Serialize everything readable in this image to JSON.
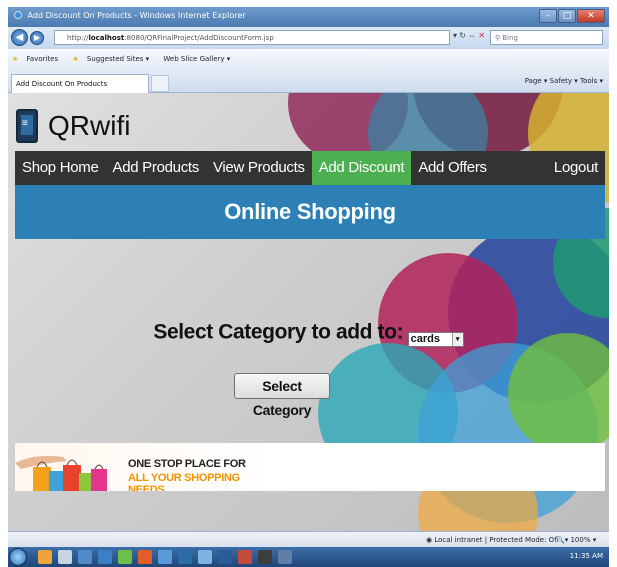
{
  "window": {
    "title": "Add Discount On Products - Windows Internet Explorer",
    "url_prefix": "http://",
    "url_host": "localhost",
    "url_rest": ":8080/QRFinalProject/AddDiscountForm.jsp",
    "search_placeholder": "Bing"
  },
  "favorites_bar": {
    "favorites_label": "Favorites",
    "suggested_sites": "Suggested Sites ▾",
    "web_slice": "Web Slice Gallery ▾"
  },
  "tab": {
    "title": "Add Discount On Products"
  },
  "command_bar": "Page ▾  Safety ▾  Tools ▾",
  "site": {
    "logo_text": "QRwifi",
    "nav": [
      {
        "label": "Shop Home"
      },
      {
        "label": "Add Products"
      },
      {
        "label": "View Products"
      },
      {
        "label": "Add Discount",
        "active": true
      },
      {
        "label": "Add Offers"
      }
    ],
    "logout_label": "Logout",
    "banner_title": "Online Shopping",
    "form": {
      "label": "Select Category to add to:",
      "selected_category": "cards",
      "submit_label": "Select Category"
    },
    "footer": {
      "line1": "ONE STOP PLACE FOR",
      "line2": "ALL YOUR SHOPPING NEEDS"
    }
  },
  "statusbar": {
    "zone": "Local intranet | Protected Mode: Off",
    "zoom": "100%"
  },
  "taskbar": {
    "time": "11:35 AM"
  },
  "colors": {
    "navbar_bg": "#333333",
    "nav_active": "#4caf50",
    "banner_bg": "#2d80b6",
    "footer_accent": "#f39200"
  }
}
